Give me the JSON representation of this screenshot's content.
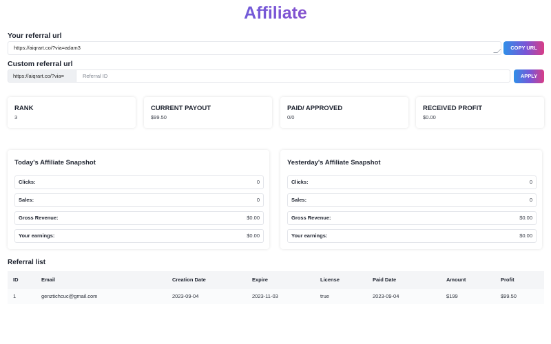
{
  "page_title": "Affiliate",
  "referral": {
    "label": "Your referral url",
    "url": "https://aiqrart.co/?via=adam3",
    "copy_label": "COPY URL"
  },
  "custom": {
    "label": "Custom referral url",
    "prefix": "https://aiqrart.co/?via=",
    "placeholder": "Referral ID",
    "apply_label": "APPLY"
  },
  "stats": [
    {
      "title": "RANK",
      "value": "3"
    },
    {
      "title": "CURRENT PAYOUT",
      "value": "$99.50"
    },
    {
      "title": "PAID/ APPROVED",
      "value": "0/0"
    },
    {
      "title": "RECEIVED PROFIT",
      "value": "$0.00"
    }
  ],
  "today": {
    "title": "Today's Affiliate Snapshot",
    "rows": [
      {
        "label": "Clicks:",
        "value": "0"
      },
      {
        "label": "Sales:",
        "value": "0"
      },
      {
        "label": "Gross Revenue:",
        "value": "$0.00"
      },
      {
        "label": "Your earnings:",
        "value": "$0.00"
      }
    ]
  },
  "yesterday": {
    "title": "Yesterday's Affiliate Snapshot",
    "rows": [
      {
        "label": "Clicks:",
        "value": "0"
      },
      {
        "label": "Sales:",
        "value": "0"
      },
      {
        "label": "Gross Revenue:",
        "value": "$0.00"
      },
      {
        "label": "Your earnings:",
        "value": "$0.00"
      }
    ]
  },
  "referral_list": {
    "title": "Referral list",
    "columns": [
      "ID",
      "Email",
      "Creation Date",
      "Expire",
      "License",
      "Paid Date",
      "Amount",
      "Profit"
    ],
    "rows": [
      [
        "1",
        "genztichcuc@gmail.com",
        "2023-09-04",
        "2023-11-03",
        "true",
        "2023-09-04",
        "$199",
        "$99.50"
      ]
    ]
  },
  "colors": {
    "gradient_start": "#2f8fe8",
    "gradient_mid": "#7a55d6",
    "gradient_end": "#d83d86"
  }
}
